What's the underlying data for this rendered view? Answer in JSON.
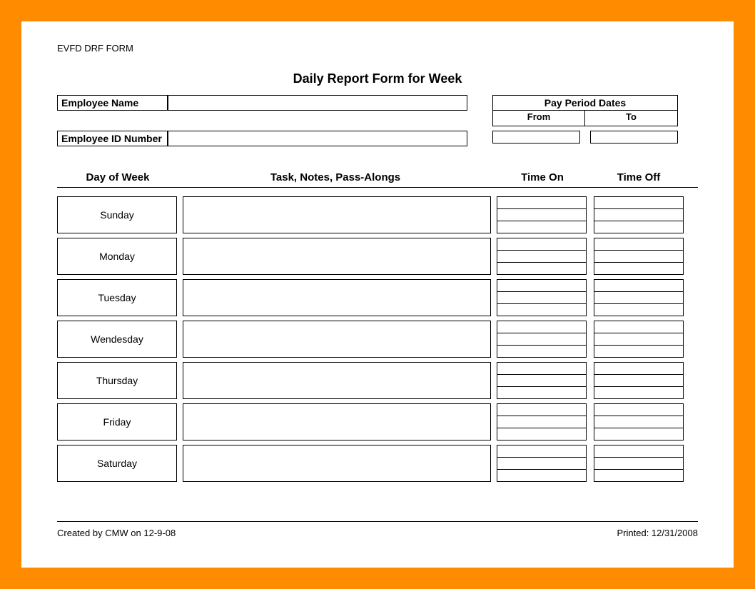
{
  "form_code": "EVFD DRF FORM",
  "title": "Daily Report Form for Week",
  "labels": {
    "employee_name": "Employee Name",
    "employee_id": "Employee ID Number",
    "pay_period": "Pay Period Dates",
    "from": "From",
    "to": "To",
    "day_of_week": "Day of Week",
    "task_notes": "Task, Notes, Pass-Alongs",
    "time_on": "Time On",
    "time_off": "Time Off"
  },
  "fields": {
    "employee_name_value": "",
    "employee_id_value": "",
    "pay_from_value": "",
    "pay_to_value": ""
  },
  "days": [
    "Sunday",
    "Monday",
    "Tuesday",
    "Wendesday",
    "Thursday",
    "Friday",
    "Saturday"
  ],
  "footer": {
    "created": "Created by CMW on 12-9-08",
    "printed": "Printed: 12/31/2008"
  }
}
